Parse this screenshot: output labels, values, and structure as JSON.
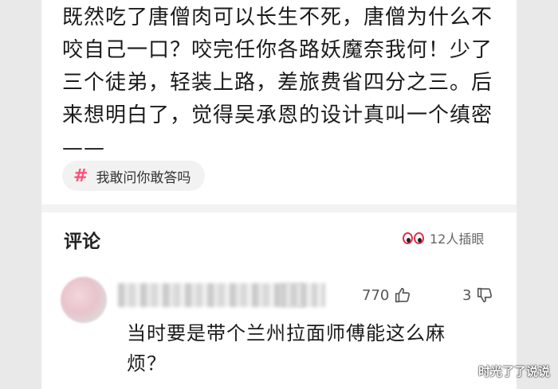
{
  "post": {
    "lines": [
      "既然吃了唐僧肉可以长生不死，唐僧为什么不",
      "咬自己一口？咬完任你各路妖魔奈我何！少了",
      "三个徒弟，轻装上路，差旅费省四分之三。后",
      "来想明白了，觉得吴承恩的设计真叫一个缜密",
      "——"
    ]
  },
  "hashtag": {
    "label": "我敢问你敢答吗",
    "icon": "hash-icon",
    "icon_glyph": "#"
  },
  "comments": {
    "title": "评论",
    "stare_count": "12人插眼",
    "stare_icon": "eyes-icon"
  },
  "comment": {
    "like_count": "770",
    "dislike_count": "3",
    "text_lines": [
      "当时要是带个兰州拉面师傅能这么麻",
      "烦？"
    ]
  },
  "watermark": "时光了了说说",
  "colors": {
    "accent": "#ff4d7a",
    "eye": "#e0304b"
  }
}
